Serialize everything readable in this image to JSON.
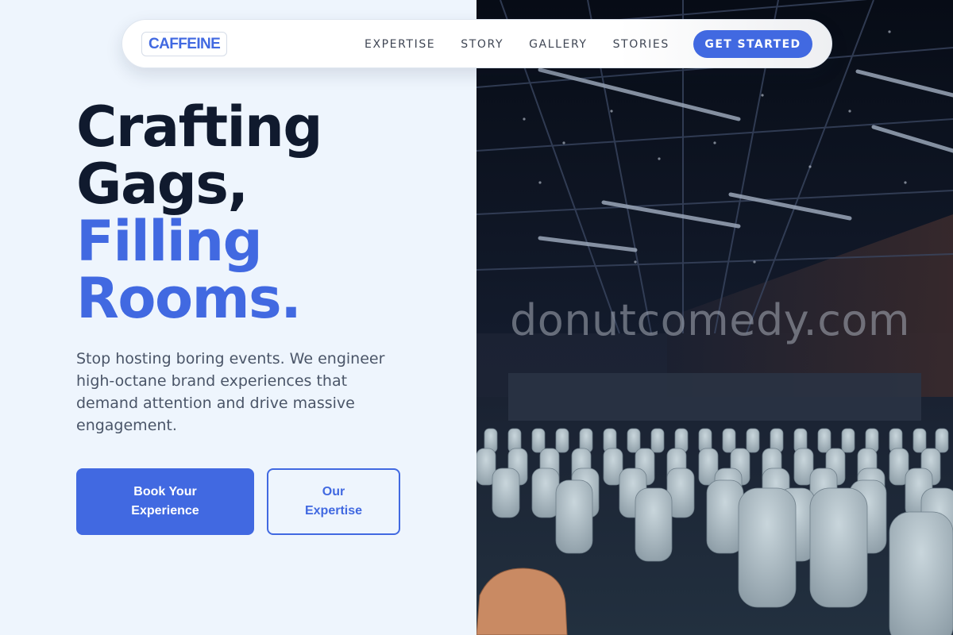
{
  "nav": {
    "logo": "CAFFEINE",
    "links": [
      "EXPERTISE",
      "STORY",
      "GALLERY",
      "STORIES"
    ],
    "cta": "GET STARTED"
  },
  "hero": {
    "title_line1": "Crafting",
    "title_line2": "Gags,",
    "title_line3": "Filling",
    "title_line4": "Rooms.",
    "subtitle": "Stop hosting boring events. We engineer high-octane brand experiences that demand attention and drive massive engagement.",
    "primary_button": "Book Your Experience",
    "secondary_button": "Our Expertise"
  },
  "image": {
    "watermark": "donutcomedy.com"
  },
  "colors": {
    "accent": "#4169e1",
    "heading": "#101a2e",
    "body_text": "#4a5568",
    "page_bg": "#eef5fd"
  }
}
